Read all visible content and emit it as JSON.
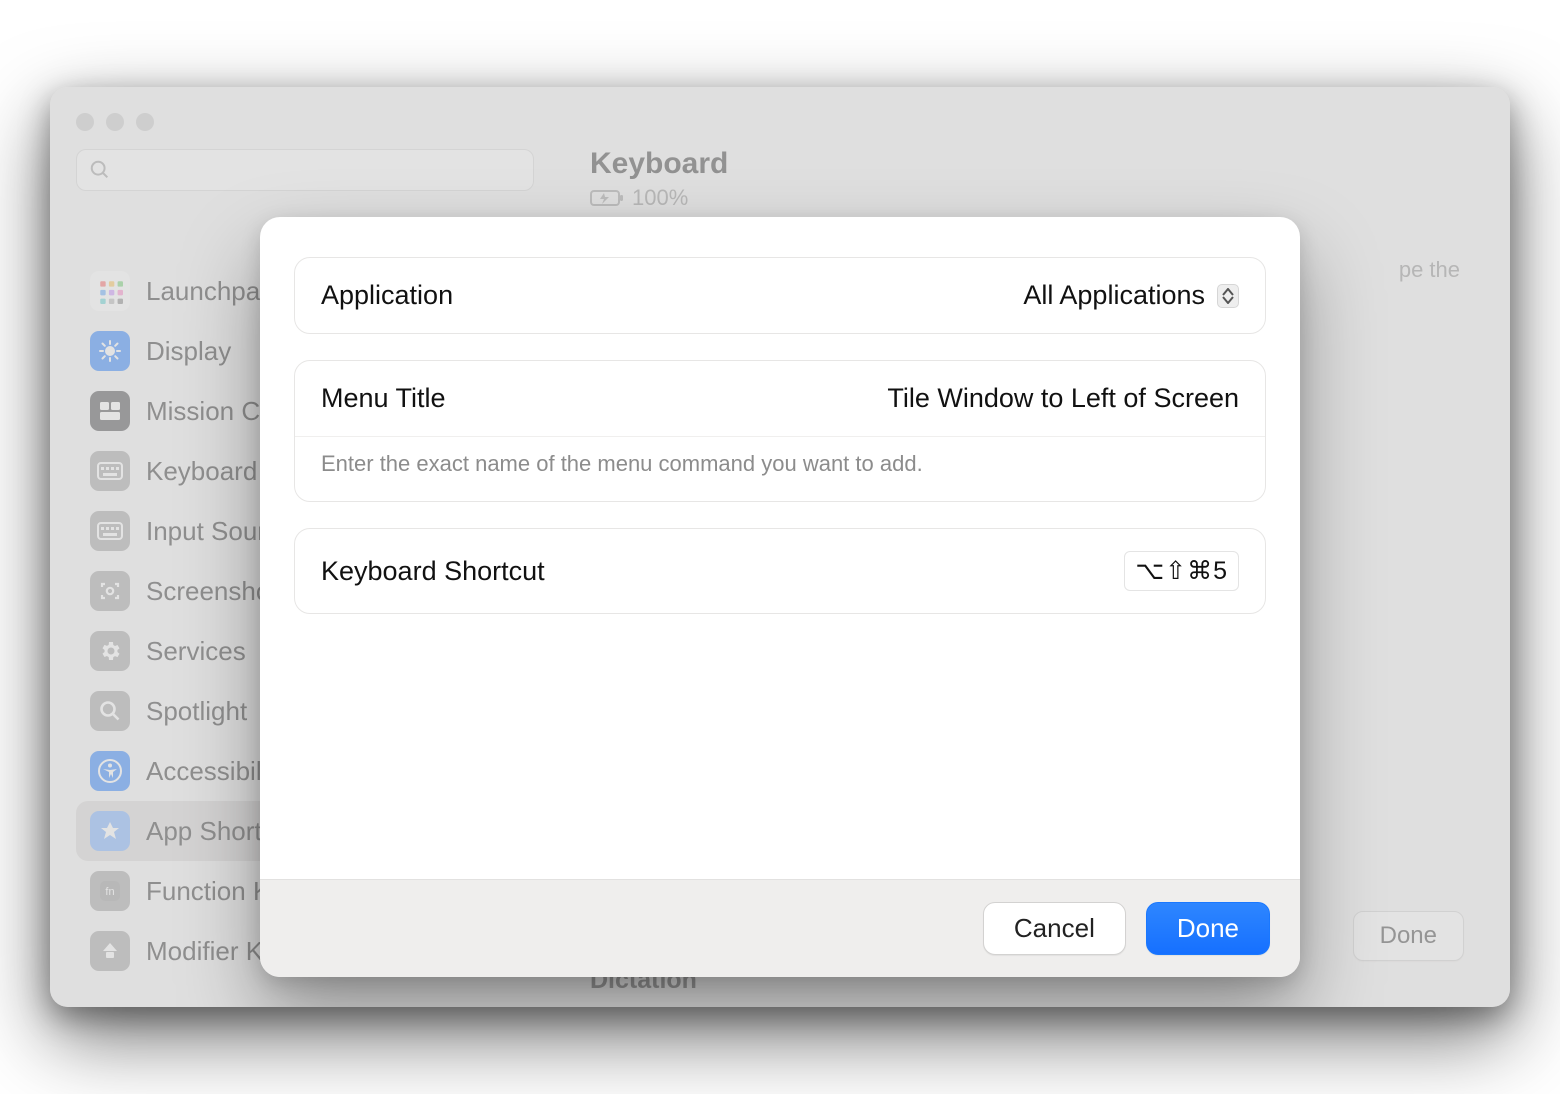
{
  "header": {
    "title": "Keyboard",
    "battery_pct": "100%"
  },
  "sidebar": {
    "items": [
      {
        "label": "Launchpad & Dock",
        "icon_bg": "#ffffff",
        "icon_name": "launchpad-icon"
      },
      {
        "label": "Display",
        "icon_bg": "#1a78ff",
        "icon_name": "brightness-icon"
      },
      {
        "label": "Mission Control",
        "icon_bg": "#3b3b3d",
        "icon_name": "mission-control-icon"
      },
      {
        "label": "Keyboard",
        "icon_bg": "#9b9b9b",
        "icon_name": "keyboard-icon"
      },
      {
        "label": "Input Sources",
        "icon_bg": "#9b9b9b",
        "icon_name": "input-sources-icon"
      },
      {
        "label": "Screenshots",
        "icon_bg": "#9b9b9b",
        "icon_name": "screenshot-icon"
      },
      {
        "label": "Services",
        "icon_bg": "#9b9b9b",
        "icon_name": "services-icon"
      },
      {
        "label": "Spotlight",
        "icon_bg": "#9b9b9b",
        "icon_name": "spotlight-icon"
      },
      {
        "label": "Accessibility",
        "icon_bg": "#1a78ff",
        "icon_name": "accessibility-icon"
      },
      {
        "label": "App Shortcuts",
        "icon_bg": "#6fa9ff",
        "icon_name": "app-shortcuts-icon",
        "selected": true
      },
      {
        "label": "Function Keys",
        "icon_bg": "#9b9b9b",
        "icon_name": "function-keys-icon"
      },
      {
        "label": "Modifier Keys",
        "icon_bg": "#9b9b9b",
        "icon_name": "modifier-keys-icon"
      }
    ]
  },
  "content": {
    "hint_fragment": "pe the",
    "section": "Dictation",
    "done_label": "Done"
  },
  "sheet": {
    "application_label": "Application",
    "application_value": "All Applications",
    "menu_title_label": "Menu Title",
    "menu_title_value": "Tile Window to Left of Screen",
    "menu_title_hint": "Enter the exact name of the menu command you want to add.",
    "shortcut_label": "Keyboard Shortcut",
    "shortcut_value": "⌥⇧⌘5",
    "cancel_label": "Cancel",
    "done_label": "Done"
  }
}
